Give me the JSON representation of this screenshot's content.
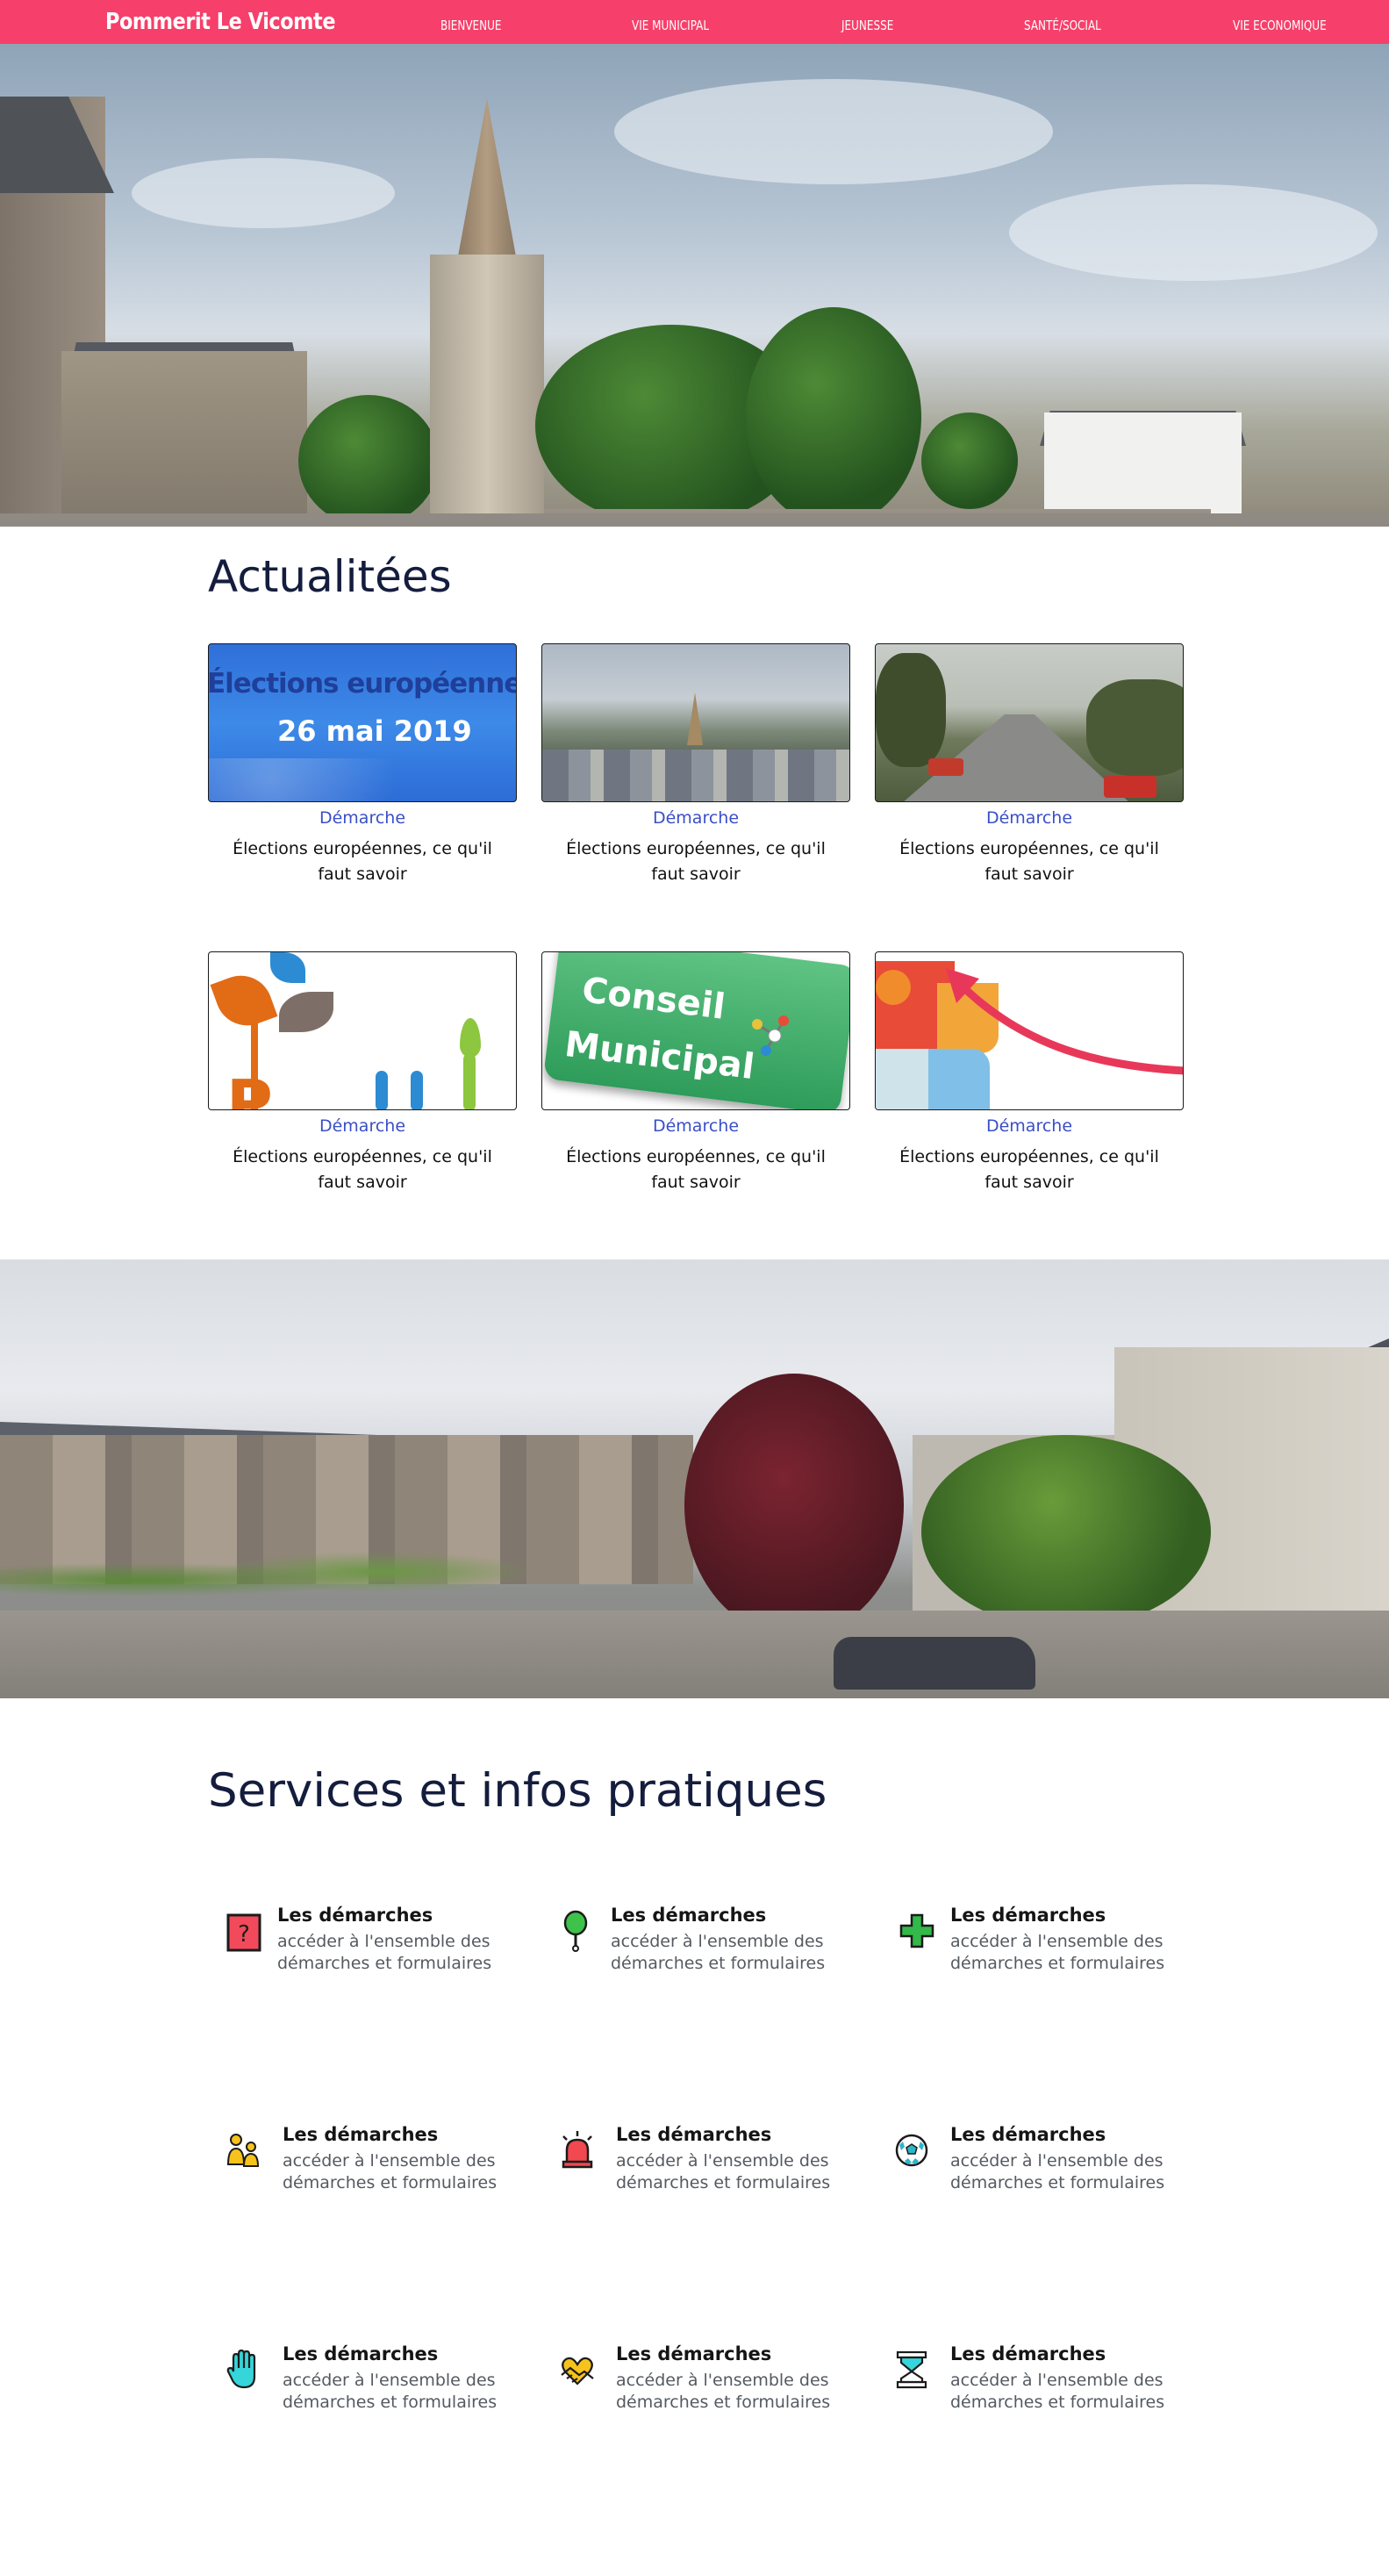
{
  "nav": {
    "brand": "Pommerit Le Vicomte",
    "items": [
      "Bienvenue",
      "Vie municipal",
      "Jeunesse",
      "Santé/Social",
      "Vie economique"
    ],
    "background": "#f63f6a"
  },
  "news": {
    "title": "Actualitées",
    "category_color": "#3a4fc7",
    "cards": [
      {
        "category": "Démarche",
        "title": "Élections européennes, ce qu'il faut savoir",
        "image": "elections-banner",
        "image_text": [
          "Élections européennes",
          "26 mai 2019"
        ]
      },
      {
        "category": "Démarche",
        "title": "Élections européennes, ce qu'il faut savoir",
        "image": "village-aerial-photo"
      },
      {
        "category": "Démarche",
        "title": "Élections européennes, ce qu'il faut savoir",
        "image": "country-road-photo"
      },
      {
        "category": "Démarche",
        "title": "Élections européennes, ce qu'il faut savoir",
        "image": "plu-logo"
      },
      {
        "category": "Démarche",
        "title": "Élections européennes, ce qu'il faut savoir",
        "image": "conseil-municipal-sign",
        "image_text": [
          "Conseil",
          "Municipal"
        ]
      },
      {
        "category": "Démarche",
        "title": "Élections européennes, ce qu'il faut savoir",
        "image": "puzzle-arrow-graphic"
      }
    ]
  },
  "services": {
    "title": "Services et infos pratiques",
    "items": [
      {
        "icon": "question-icon",
        "title": "Les démarches",
        "desc": "accéder à l'ensemble des démarches et formulaires"
      },
      {
        "icon": "rattle-icon",
        "title": "Les démarches",
        "desc": "accéder à l'ensemble des démarches et formulaires"
      },
      {
        "icon": "medical-cross-icon",
        "title": "Les démarches",
        "desc": "accéder à l'ensemble des démarches et formulaires"
      },
      {
        "icon": "people-icon",
        "title": "Les démarches",
        "desc": "accéder à l'ensemble des démarches et formulaires"
      },
      {
        "icon": "alarm-bell-icon",
        "title": "Les démarches",
        "desc": "accéder à l'ensemble des démarches et formulaires"
      },
      {
        "icon": "soccer-ball-icon",
        "title": "Les démarches",
        "desc": "accéder à l'ensemble des démarches et formulaires"
      },
      {
        "icon": "hand-icon",
        "title": "Les démarches",
        "desc": "accéder à l'ensemble des démarches et formulaires"
      },
      {
        "icon": "handshake-heart-icon",
        "title": "Les démarches",
        "desc": "accéder à l'ensemble des démarches et formulaires"
      },
      {
        "icon": "hourglass-icon",
        "title": "Les démarches",
        "desc": "accéder à l'ensemble des démarches et formulaires"
      }
    ]
  }
}
